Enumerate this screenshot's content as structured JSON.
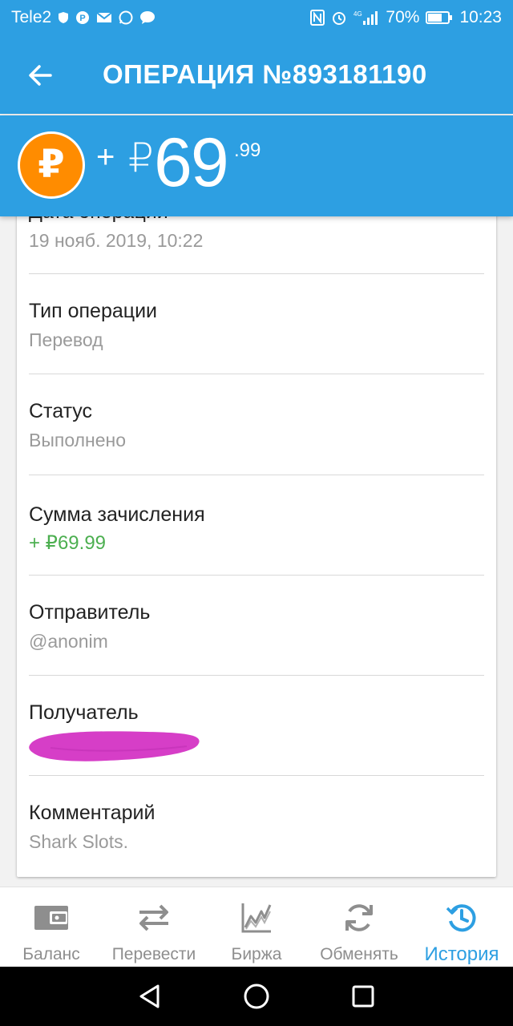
{
  "status_bar": {
    "carrier": "Tele2",
    "battery": "70%",
    "time": "10:23",
    "network_type": "4G"
  },
  "header": {
    "title": "ОПЕРАЦИЯ №893181190"
  },
  "amount": {
    "sign": "+",
    "currency_symbol": "₽",
    "integer": "69",
    "decimal": ".99",
    "coin_symbol": "₽",
    "coin_color": "#ff8c00"
  },
  "details": [
    {
      "label": "Дата операции",
      "value": "19 нояб. 2019, 10:22"
    },
    {
      "label": "Тип операции",
      "value": "Перевод"
    },
    {
      "label": "Статус",
      "value": "Выполнено"
    },
    {
      "label": "Сумма зачисления",
      "value": "+ ₽69.99"
    },
    {
      "label": "Отправитель",
      "value": "@anonim"
    },
    {
      "label": "Получатель",
      "value": ""
    },
    {
      "label": "Комментарий",
      "value": "Shark Slots."
    }
  ],
  "nav": {
    "items": [
      {
        "label": "Баланс",
        "icon": "wallet-icon"
      },
      {
        "label": "Перевести",
        "icon": "transfer-icon"
      },
      {
        "label": "Биржа",
        "icon": "chart-icon"
      },
      {
        "label": "Обменять",
        "icon": "exchange-icon"
      },
      {
        "label": "История",
        "icon": "history-icon",
        "active": true
      }
    ]
  },
  "colors": {
    "primary": "#2d9fe2",
    "positive": "#4caf50",
    "redaction": "#d63ec7"
  }
}
